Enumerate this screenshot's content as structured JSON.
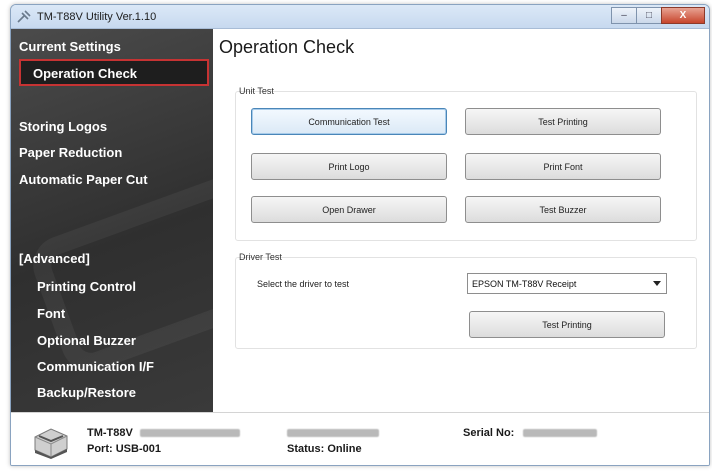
{
  "window": {
    "title": "TM-T88V Utility Ver.1.10",
    "controls": {
      "minimize": "–",
      "maximize": "□",
      "close": "X"
    }
  },
  "sidebar": {
    "items": [
      {
        "label": "Current Settings",
        "name": "sidebar-item-current-settings"
      },
      {
        "label": "Operation Check",
        "name": "sidebar-item-operation-check",
        "active": true
      },
      {
        "label": "Storing Logos",
        "name": "sidebar-item-storing-logos"
      },
      {
        "label": "Paper Reduction",
        "name": "sidebar-item-paper-reduction"
      },
      {
        "label": "Automatic Paper Cut",
        "name": "sidebar-item-automatic-paper-cut"
      }
    ],
    "advanced_header": "[Advanced]",
    "advanced_items": [
      {
        "label": "Printing Control"
      },
      {
        "label": "Font"
      },
      {
        "label": "Optional Buzzer"
      },
      {
        "label": "Communication I/F"
      },
      {
        "label": "Backup/Restore"
      }
    ]
  },
  "main": {
    "title": "Operation Check",
    "unit_test": {
      "label": "Unit Test",
      "buttons": {
        "communication_test": "Communication Test",
        "test_printing": "Test Printing",
        "print_logo": "Print Logo",
        "print_font": "Print Font",
        "open_drawer": "Open Drawer",
        "test_buzzer": "Test Buzzer"
      }
    },
    "driver_test": {
      "label": "Driver Test",
      "select_label": "Select the driver to test",
      "selected_driver": "EPSON TM-T88V Receipt",
      "test_printing": "Test Printing"
    }
  },
  "status": {
    "model": "TM-T88V",
    "port": "Port: USB-001",
    "status": "Status: Online",
    "serial_label": "Serial No:"
  },
  "colors": {
    "sidebar_bg": "#3a3a3a",
    "active_border": "#c63333",
    "focus_border": "#4a86b8"
  }
}
